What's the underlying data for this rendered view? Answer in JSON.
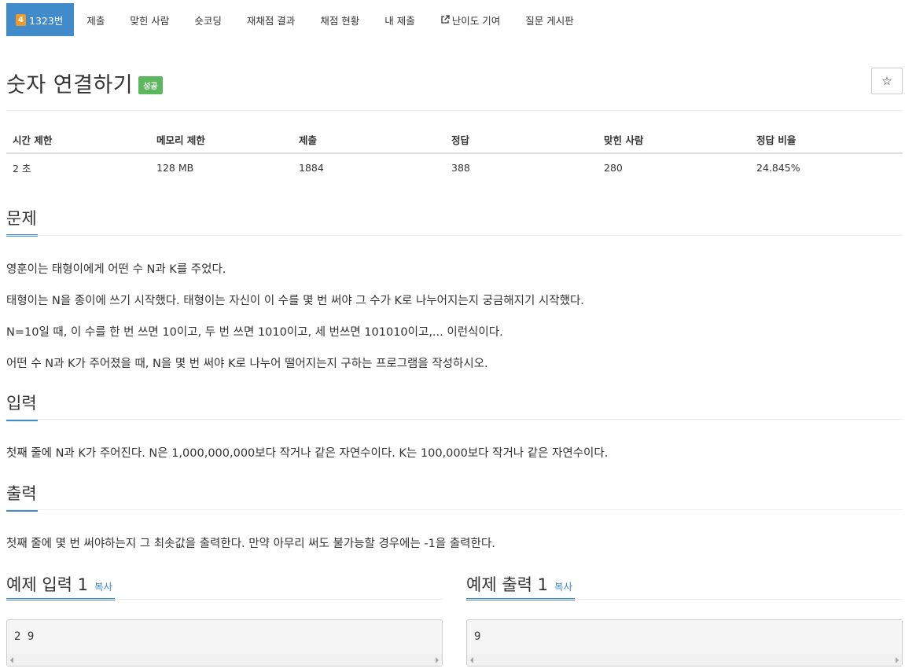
{
  "tabs": [
    {
      "label": "1323번",
      "badge": "4",
      "active": true
    },
    {
      "label": "제출"
    },
    {
      "label": "맞힌 사람"
    },
    {
      "label": "숏코딩"
    },
    {
      "label": "재채점 결과"
    },
    {
      "label": "채점 현황"
    },
    {
      "label": "내 제출"
    },
    {
      "label": "난이도 기여"
    },
    {
      "label": "질문 게시판"
    }
  ],
  "problem": {
    "title": "숫자 연결하기",
    "result_badge": "성공",
    "star": "☆"
  },
  "info": {
    "headers": [
      "시간 제한",
      "메모리 제한",
      "제출",
      "정답",
      "맞힌 사람",
      "정답 비율"
    ],
    "values": [
      "2 초",
      "128 MB",
      "1884",
      "388",
      "280",
      "24.845%"
    ]
  },
  "sections": {
    "description_title": "문제",
    "description": [
      "영훈이는 태형이에게 어떤 수 N과 K를 주었다.",
      "태형이는 N을 종이에 쓰기 시작했다. 태형이는 자신이 이 수를 몇 번 써야 그 수가 K로 나누어지는지 궁금해지기 시작했다.",
      "N=10일 때, 이 수를 한 번 쓰면 10이고, 두 번 쓰면 1010이고, 세 번쓰면 101010이고,... 이런식이다.",
      "어떤 수 N과 K가 주어졌을 때, N을 몇 번 써야 K로 나누어 떨어지는지 구하는 프로그램을 작성하시오."
    ],
    "input_title": "입력",
    "input": "첫째 줄에 N과 K가 주어진다. N은 1,000,000,000보다 작거나 같은 자연수이다. K는 100,000보다 작거나 같은 자연수이다.",
    "output_title": "출력",
    "output": "첫째 줄에 몇 번 써야하는지 그 최솟값을 출력한다. 만약 아무리 써도 불가능할 경우에는 -1을 출력한다."
  },
  "samples": {
    "input_title": "예제 입력 1",
    "output_title": "예제 출력 1",
    "copy_label": "복사",
    "input_value": "2 9",
    "output_value": "9"
  }
}
